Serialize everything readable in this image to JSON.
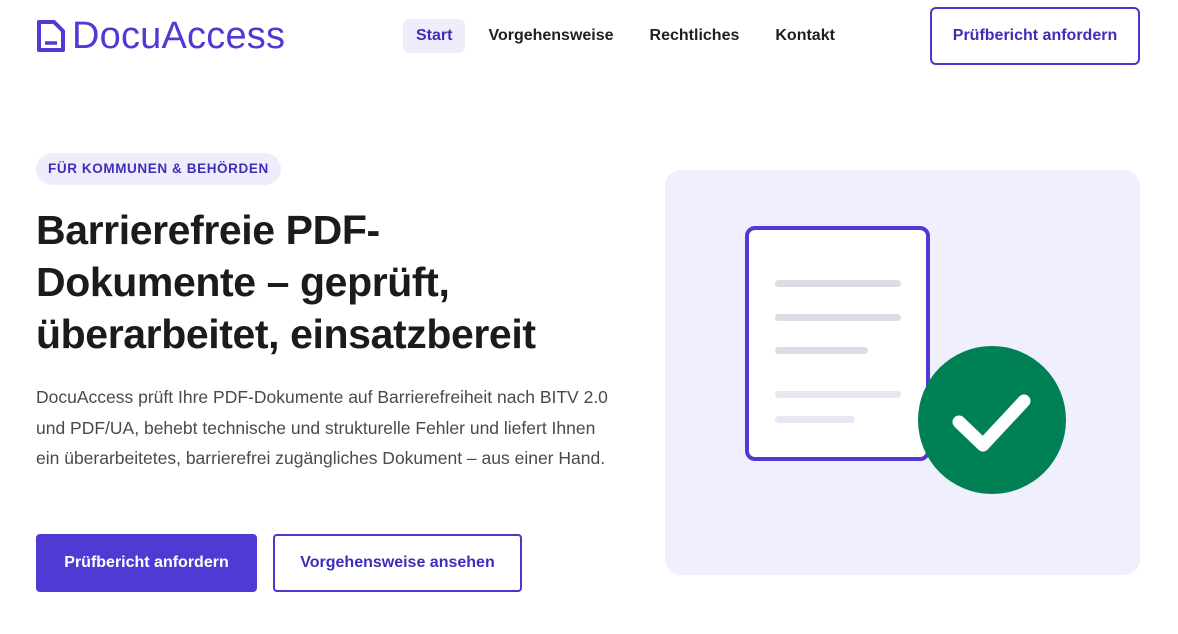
{
  "brand": {
    "name": "DocuAccess",
    "icon": "document-icon",
    "color": "#4f3bd3"
  },
  "nav": {
    "items": [
      {
        "label": "Start",
        "active": true
      },
      {
        "label": "Vorgehensweise",
        "active": false
      },
      {
        "label": "Rechtliches",
        "active": false
      },
      {
        "label": "Kontakt",
        "active": false
      }
    ],
    "cta_label": "Prüfbericht anfordern"
  },
  "hero": {
    "badge": "FÜR KOMMUNEN & BEHÖRDEN",
    "headline_lines": [
      "Barrierefreie PDF-",
      "Dokumente – geprüft,",
      "überarbeitet, einsatzbereit"
    ],
    "lead": "DocuAccess prüft Ihre PDF-Dokumente auf Barrierefreiheit nach BITV 2.0 und PDF/UA, behebt technische und strukturelle Fehler und liefert Ihnen ein überarbeitetes, barrierefrei zugängliches Dokument – aus einer Hand.",
    "primary_button": "Prüfbericht anfordern",
    "secondary_button": "Vorgehensweise ansehen"
  },
  "illustration": {
    "icons": [
      "document-icon",
      "checkmark-icon"
    ],
    "colors": {
      "background": "#efeffd",
      "document_border": "#4f3bd3",
      "check_circle": "#008155",
      "lines": "#dcdce6"
    }
  }
}
